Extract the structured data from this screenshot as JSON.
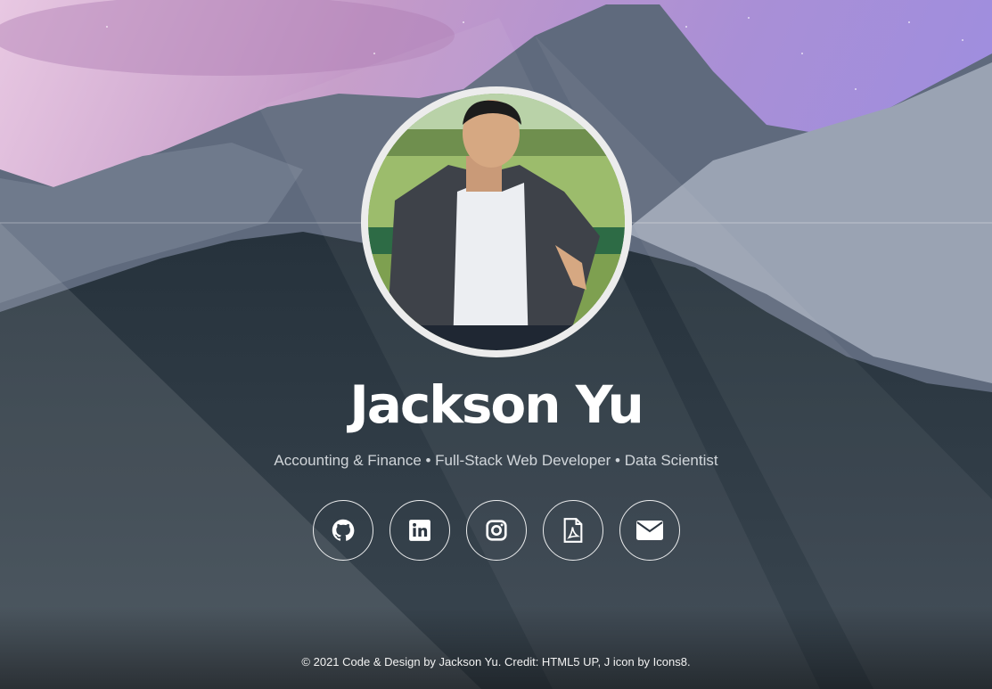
{
  "profile": {
    "name": "Jackson Yu",
    "tagline": "Accounting & Finance • Full-Stack Web Developer • Data Scientist"
  },
  "socials": [
    {
      "icon": "github-icon"
    },
    {
      "icon": "linkedin-icon"
    },
    {
      "icon": "instagram-icon"
    },
    {
      "icon": "pdf-resume-icon"
    },
    {
      "icon": "email-icon"
    }
  ],
  "footer": {
    "text": "© 2021 Code & Design by Jackson Yu. Credit: HTML5 UP, J icon by Icons8."
  },
  "colors": {
    "sky_purple": "#c8a6d8",
    "mountain": "#566273",
    "forest": "#1e2a33",
    "text": "#ffffff"
  }
}
